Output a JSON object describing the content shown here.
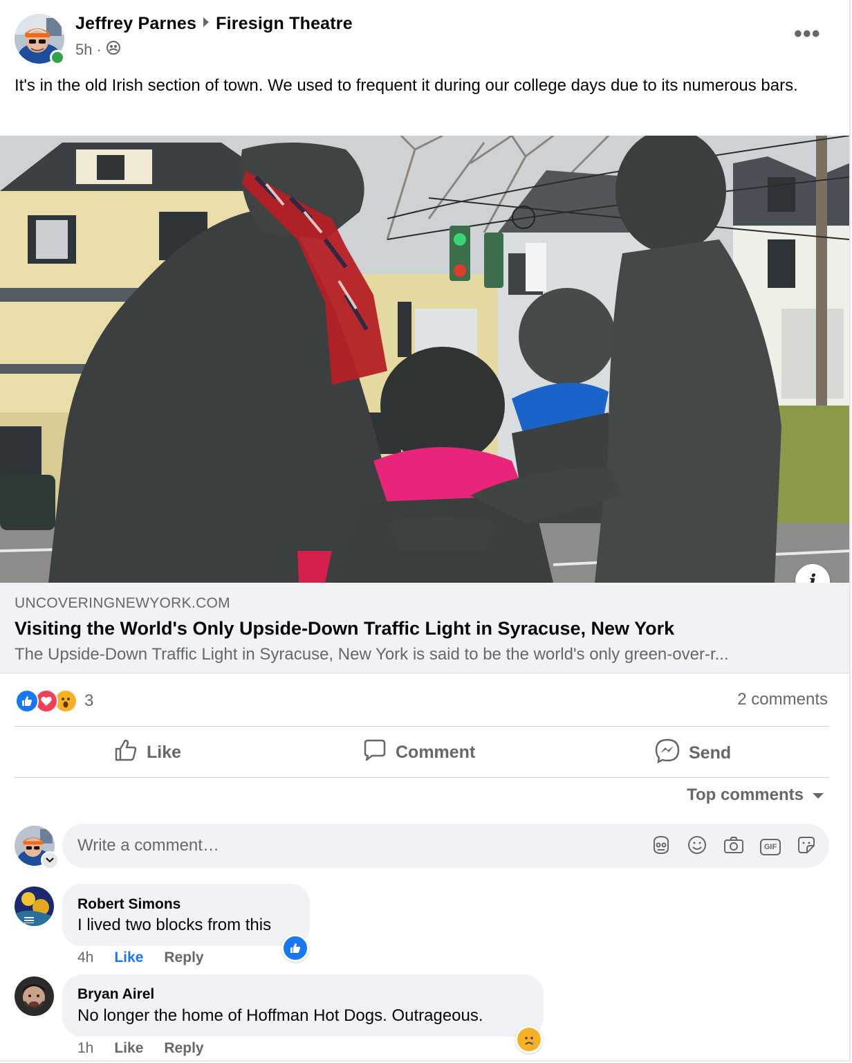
{
  "post": {
    "author": "Jeffrey Parnes",
    "group": "Firesign Theatre",
    "time": "5h",
    "time_separator": "·",
    "audience_icon": "group-privacy-icon",
    "more_label": "•••",
    "text": "It's in the old Irish section of town. We used to frequent it during our college days due to its numerous bars."
  },
  "link_preview": {
    "domain": "UNCOVERINGNEWYORK.COM",
    "title": "Visiting the World's Only Upside-Down Traffic Light in Syracuse, New York",
    "description": "The Upside-Down Traffic Light in Syracuse, New York is said to be the world's only green-over-r...",
    "info_label": "i",
    "image_icon": "statue-photo"
  },
  "reactions": {
    "icons": [
      "like-reaction-icon",
      "love-reaction-icon",
      "wow-reaction-icon"
    ],
    "count": "3",
    "comments_count": "2 comments"
  },
  "actions": {
    "like": "Like",
    "comment": "Comment",
    "send": "Send"
  },
  "comments_section": {
    "sort_label": "Top comments",
    "composer_placeholder": "Write a comment…",
    "composer_icons": [
      "avatar-sticker-icon",
      "emoji-icon",
      "camera-icon",
      "gif-icon",
      "sticker-icon"
    ],
    "gif_label": "GIF",
    "comments": [
      {
        "name": "Robert Simons",
        "text": "I lived two blocks from this",
        "time": "4h",
        "like": "Like",
        "reply": "Reply",
        "reaction": "like-reaction-icon"
      },
      {
        "name": "Bryan Airel",
        "text": "No longer the home of Hoffman Hot Dogs. Outrageous.",
        "time": "1h",
        "like": "Like",
        "reply": "Reply",
        "reaction": "sad-reaction-icon"
      }
    ]
  },
  "colors": {
    "brand_blue": "#1877f2",
    "secondary_text": "#65676b",
    "bubble_bg": "#f0f2f5",
    "online_green": "#31a24c",
    "love_red": "#f33e58",
    "wow_yellow": "#f7b125"
  }
}
